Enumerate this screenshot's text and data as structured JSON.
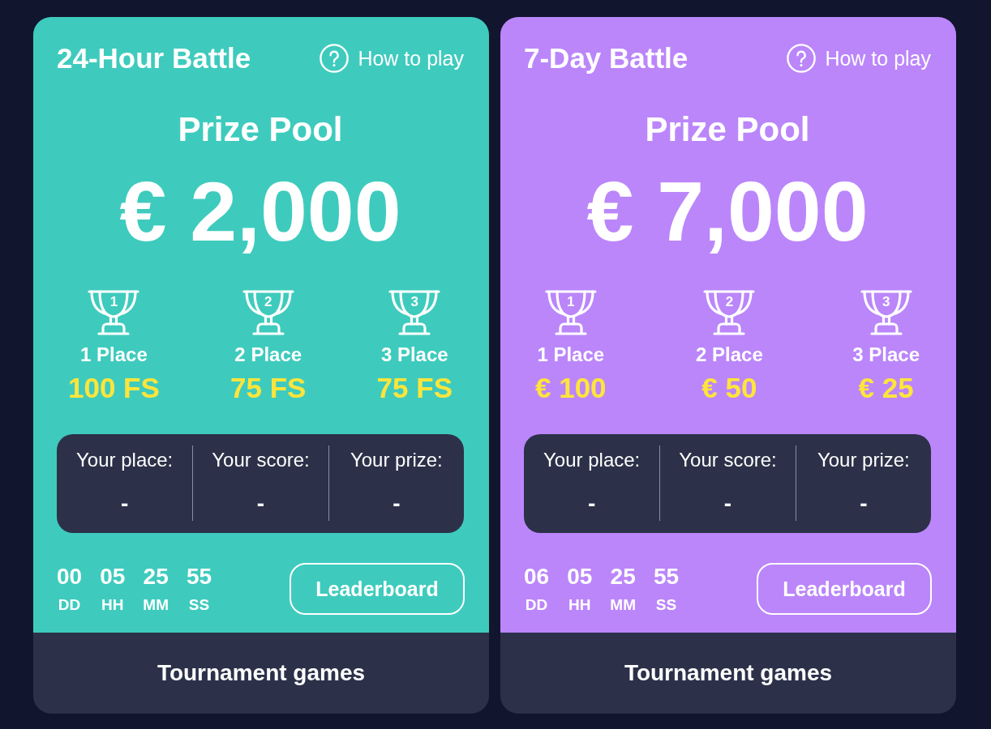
{
  "tournaments": [
    {
      "title": "24-Hour Battle",
      "color": "#3ecbbd",
      "help_link": "How to play",
      "prize_pool_label": "Prize Pool",
      "prize_pool": "€ 2,000",
      "places": [
        {
          "rank": "1",
          "label": "1 Place",
          "prize": "100 FS"
        },
        {
          "rank": "2",
          "label": "2 Place",
          "prize": "75 FS"
        },
        {
          "rank": "3",
          "label": "3 Place",
          "prize": "75 FS"
        }
      ],
      "stats": [
        {
          "label": "Your place:",
          "value": "-"
        },
        {
          "label": "Your score:",
          "value": "-"
        },
        {
          "label": "Your prize:",
          "value": "-"
        }
      ],
      "countdown": [
        {
          "value": "00",
          "unit": "DD"
        },
        {
          "value": "05",
          "unit": "HH"
        },
        {
          "value": "25",
          "unit": "MM"
        },
        {
          "value": "55",
          "unit": "SS"
        }
      ],
      "leaderboard_button": "Leaderboard",
      "footer_button": "Tournament games"
    },
    {
      "title": "7-Day Battle",
      "color": "#bb86fa",
      "help_link": "How to play",
      "prize_pool_label": "Prize Pool",
      "prize_pool": "€ 7,000",
      "places": [
        {
          "rank": "1",
          "label": "1 Place",
          "prize": "€ 100"
        },
        {
          "rank": "2",
          "label": "2 Place",
          "prize": "€ 50"
        },
        {
          "rank": "3",
          "label": "3 Place",
          "prize": "€ 25"
        }
      ],
      "stats": [
        {
          "label": "Your place:",
          "value": "-"
        },
        {
          "label": "Your score:",
          "value": "-"
        },
        {
          "label": "Your prize:",
          "value": "-"
        }
      ],
      "countdown": [
        {
          "value": "06",
          "unit": "DD"
        },
        {
          "value": "05",
          "unit": "HH"
        },
        {
          "value": "25",
          "unit": "MM"
        },
        {
          "value": "55",
          "unit": "SS"
        }
      ],
      "leaderboard_button": "Leaderboard",
      "footer_button": "Tournament games"
    }
  ]
}
